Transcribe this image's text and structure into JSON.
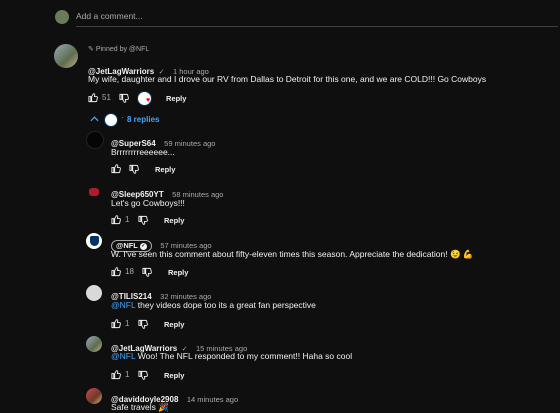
{
  "add_comment": {
    "placeholder": "Add a comment..."
  },
  "pinned": {
    "label": "Pinned by @NFL"
  },
  "top_comment": {
    "author": "@JetLagWarriors",
    "time": "1 hour ago",
    "text": "My wife, daughter and I drove our RV from Dallas to Detroit for this one, and we are COLD!!! Go Cowboys",
    "likes": "51",
    "reply_label": "Reply"
  },
  "replies_toggle": {
    "label": "8 replies"
  },
  "replies": [
    {
      "author": "@SuperS64",
      "time": "59 minutes ago",
      "text": "Brrrrrrrreeeeee...",
      "likes": "",
      "reply_label": "Reply"
    },
    {
      "author": "@Sleep650YT",
      "time": "58 minutes ago",
      "text": "Let's go Cowboys!!!",
      "likes": "1",
      "reply_label": "Reply"
    },
    {
      "author": "@NFL",
      "time": "57 minutes ago",
      "text": "W. I've seen this comment about fifty-eleven times this season. Appreciate the dedication! 😉 💪",
      "likes": "18",
      "reply_label": "Reply"
    },
    {
      "author": "@TILIS214",
      "time": "32 minutes ago",
      "mention": "@NFL",
      "text": "they videos dope too its a great fan perspective",
      "likes": "1",
      "reply_label": "Reply"
    },
    {
      "author": "@JetLagWarriors",
      "time": "15 minutes ago",
      "mention": "@NFL",
      "text": "Woo! The NFL responded to my comment!! Haha so cool",
      "likes": "1",
      "reply_label": "Reply"
    },
    {
      "author": "@daviddoyle2908",
      "time": "14 minutes ago",
      "text": "Safe travels 🎉"
    }
  ],
  "colors": {
    "background": "#0f0f0f",
    "text": "#f1f1f1",
    "muted": "#aaaaaa",
    "link": "#3ea6ff"
  }
}
